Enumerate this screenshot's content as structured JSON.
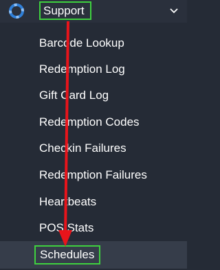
{
  "header": {
    "icon": "lifebuoy-icon",
    "label": "Support",
    "chevron_icon": "chevron-down-icon"
  },
  "menu": {
    "items": [
      {
        "label": "Barcode Lookup"
      },
      {
        "label": "Redemption Log"
      },
      {
        "label": "Gift Card Log"
      },
      {
        "label": "Redemption Codes"
      },
      {
        "label": "Checkin Failures"
      },
      {
        "label": "Redemption Failures"
      },
      {
        "label": "Heartbeats"
      },
      {
        "label": "POS Stats"
      }
    ],
    "active_item": {
      "label": "Schedules"
    }
  },
  "colors": {
    "background": "#252b36",
    "header_background": "#2a303c",
    "active_row": "#363d4a",
    "highlight_box": "#3fd13f",
    "arrow": "#e8141b",
    "icon": "#2f7fd8",
    "text": "#ffffff"
  }
}
